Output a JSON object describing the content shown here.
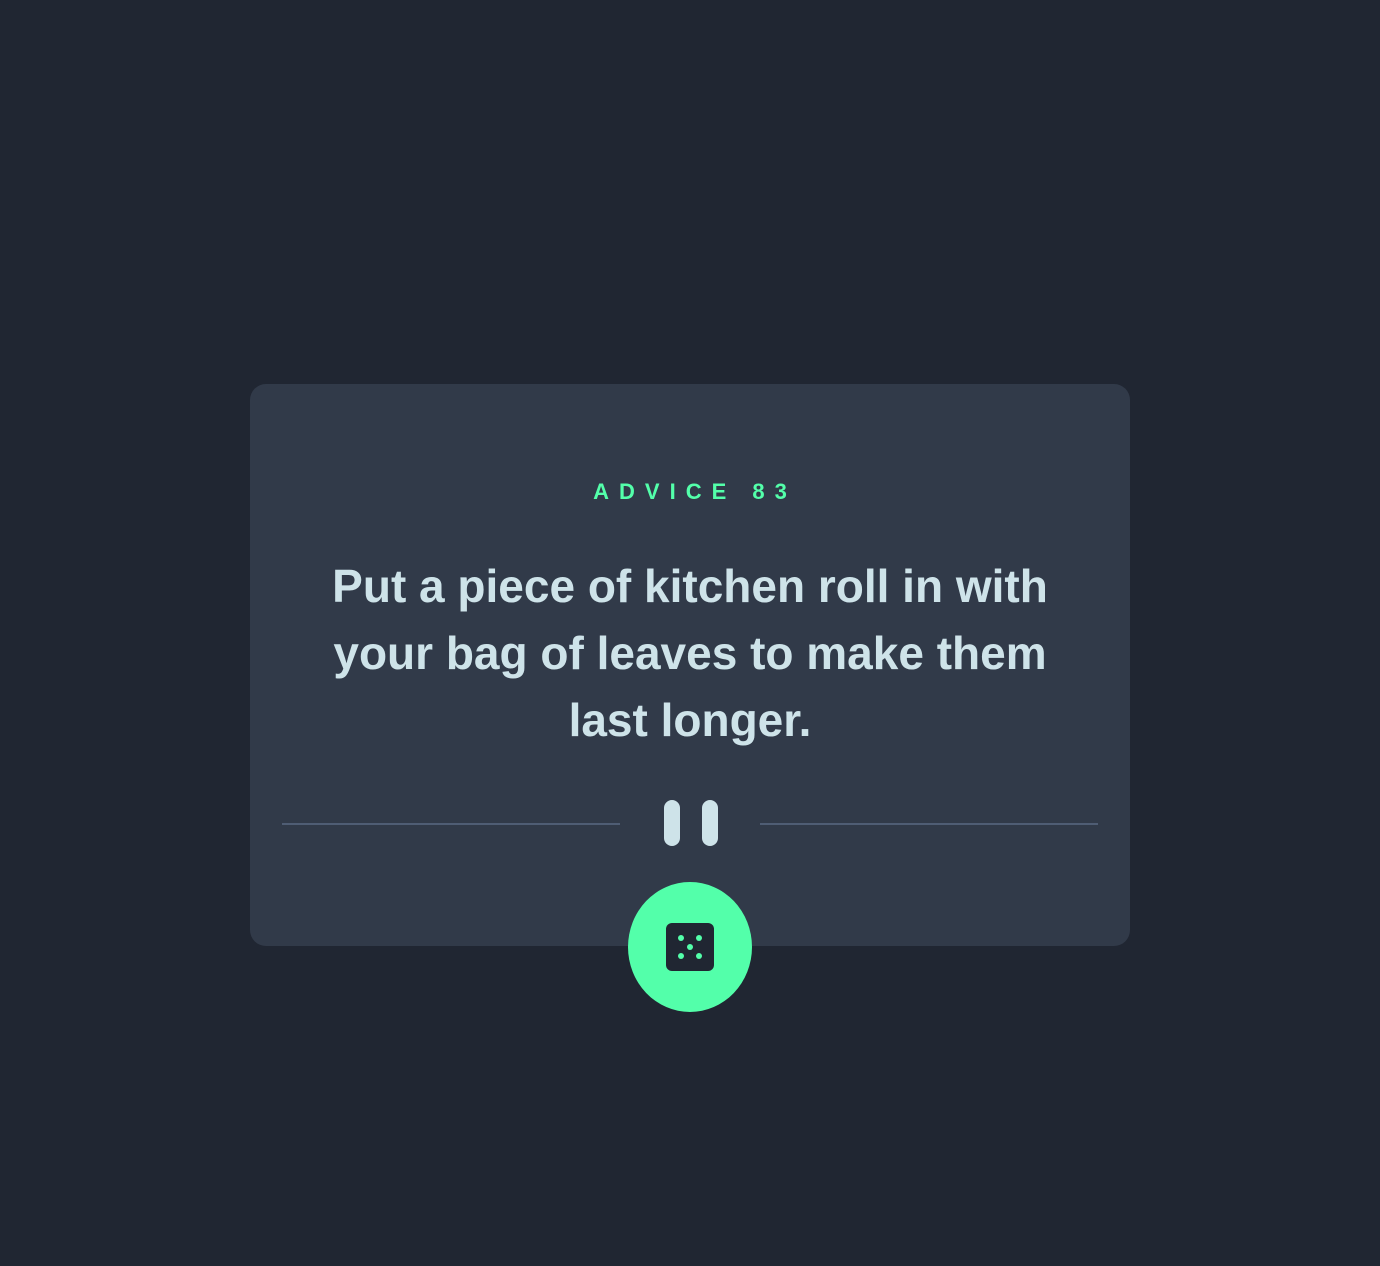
{
  "advice": {
    "label": "ADVICE 83",
    "quote": "Put a piece of kitchen roll in with your bag of leaves to make them last longer."
  },
  "divider": {
    "icon": "pause-icon"
  },
  "button": {
    "icon": "dice-icon",
    "aria_label": "Generate new advice"
  },
  "colors": {
    "background": "#202632",
    "card": "#313A49",
    "accent": "#53FFAA",
    "text": "#CEE3E9",
    "divider": "#4F5D74"
  }
}
